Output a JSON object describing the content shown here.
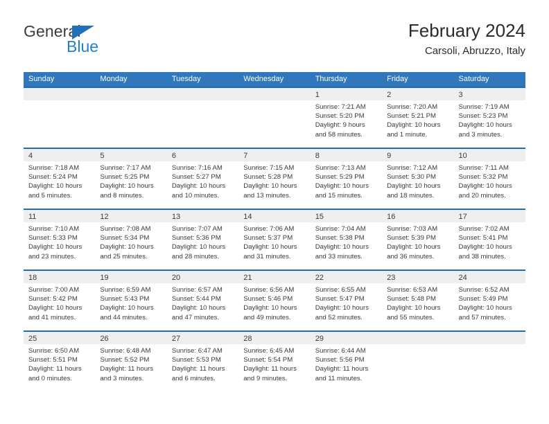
{
  "brand": {
    "name_part1": "General",
    "name_part2": "Blue",
    "icon": "triangle-logo-icon",
    "color_primary": "#1f7fd0",
    "color_text": "#3c3c3c"
  },
  "header": {
    "title": "February 2024",
    "subtitle": "Carsoli, Abruzzo, Italy"
  },
  "theme": {
    "header_bar": "#3077bc",
    "row_divider": "#1f6cb0",
    "day_band": "#efefef",
    "text": "#3a3a3a"
  },
  "weekdays": [
    "Sunday",
    "Monday",
    "Tuesday",
    "Wednesday",
    "Thursday",
    "Friday",
    "Saturday"
  ],
  "weeks": [
    [
      {
        "day": "",
        "sunrise": "",
        "sunset": "",
        "daylight": "",
        "empty": true
      },
      {
        "day": "",
        "sunrise": "",
        "sunset": "",
        "daylight": "",
        "empty": true
      },
      {
        "day": "",
        "sunrise": "",
        "sunset": "",
        "daylight": "",
        "empty": true
      },
      {
        "day": "",
        "sunrise": "",
        "sunset": "",
        "daylight": "",
        "empty": true
      },
      {
        "day": "1",
        "sunrise": "Sunrise: 7:21 AM",
        "sunset": "Sunset: 5:20 PM",
        "daylight": "Daylight: 9 hours and 58 minutes.",
        "empty": false
      },
      {
        "day": "2",
        "sunrise": "Sunrise: 7:20 AM",
        "sunset": "Sunset: 5:21 PM",
        "daylight": "Daylight: 10 hours and 1 minute.",
        "empty": false
      },
      {
        "day": "3",
        "sunrise": "Sunrise: 7:19 AM",
        "sunset": "Sunset: 5:23 PM",
        "daylight": "Daylight: 10 hours and 3 minutes.",
        "empty": false
      }
    ],
    [
      {
        "day": "4",
        "sunrise": "Sunrise: 7:18 AM",
        "sunset": "Sunset: 5:24 PM",
        "daylight": "Daylight: 10 hours and 5 minutes.",
        "empty": false
      },
      {
        "day": "5",
        "sunrise": "Sunrise: 7:17 AM",
        "sunset": "Sunset: 5:25 PM",
        "daylight": "Daylight: 10 hours and 8 minutes.",
        "empty": false
      },
      {
        "day": "6",
        "sunrise": "Sunrise: 7:16 AM",
        "sunset": "Sunset: 5:27 PM",
        "daylight": "Daylight: 10 hours and 10 minutes.",
        "empty": false
      },
      {
        "day": "7",
        "sunrise": "Sunrise: 7:15 AM",
        "sunset": "Sunset: 5:28 PM",
        "daylight": "Daylight: 10 hours and 13 minutes.",
        "empty": false
      },
      {
        "day": "8",
        "sunrise": "Sunrise: 7:13 AM",
        "sunset": "Sunset: 5:29 PM",
        "daylight": "Daylight: 10 hours and 15 minutes.",
        "empty": false
      },
      {
        "day": "9",
        "sunrise": "Sunrise: 7:12 AM",
        "sunset": "Sunset: 5:30 PM",
        "daylight": "Daylight: 10 hours and 18 minutes.",
        "empty": false
      },
      {
        "day": "10",
        "sunrise": "Sunrise: 7:11 AM",
        "sunset": "Sunset: 5:32 PM",
        "daylight": "Daylight: 10 hours and 20 minutes.",
        "empty": false
      }
    ],
    [
      {
        "day": "11",
        "sunrise": "Sunrise: 7:10 AM",
        "sunset": "Sunset: 5:33 PM",
        "daylight": "Daylight: 10 hours and 23 minutes.",
        "empty": false
      },
      {
        "day": "12",
        "sunrise": "Sunrise: 7:08 AM",
        "sunset": "Sunset: 5:34 PM",
        "daylight": "Daylight: 10 hours and 25 minutes.",
        "empty": false
      },
      {
        "day": "13",
        "sunrise": "Sunrise: 7:07 AM",
        "sunset": "Sunset: 5:36 PM",
        "daylight": "Daylight: 10 hours and 28 minutes.",
        "empty": false
      },
      {
        "day": "14",
        "sunrise": "Sunrise: 7:06 AM",
        "sunset": "Sunset: 5:37 PM",
        "daylight": "Daylight: 10 hours and 31 minutes.",
        "empty": false
      },
      {
        "day": "15",
        "sunrise": "Sunrise: 7:04 AM",
        "sunset": "Sunset: 5:38 PM",
        "daylight": "Daylight: 10 hours and 33 minutes.",
        "empty": false
      },
      {
        "day": "16",
        "sunrise": "Sunrise: 7:03 AM",
        "sunset": "Sunset: 5:39 PM",
        "daylight": "Daylight: 10 hours and 36 minutes.",
        "empty": false
      },
      {
        "day": "17",
        "sunrise": "Sunrise: 7:02 AM",
        "sunset": "Sunset: 5:41 PM",
        "daylight": "Daylight: 10 hours and 38 minutes.",
        "empty": false
      }
    ],
    [
      {
        "day": "18",
        "sunrise": "Sunrise: 7:00 AM",
        "sunset": "Sunset: 5:42 PM",
        "daylight": "Daylight: 10 hours and 41 minutes.",
        "empty": false
      },
      {
        "day": "19",
        "sunrise": "Sunrise: 6:59 AM",
        "sunset": "Sunset: 5:43 PM",
        "daylight": "Daylight: 10 hours and 44 minutes.",
        "empty": false
      },
      {
        "day": "20",
        "sunrise": "Sunrise: 6:57 AM",
        "sunset": "Sunset: 5:44 PM",
        "daylight": "Daylight: 10 hours and 47 minutes.",
        "empty": false
      },
      {
        "day": "21",
        "sunrise": "Sunrise: 6:56 AM",
        "sunset": "Sunset: 5:46 PM",
        "daylight": "Daylight: 10 hours and 49 minutes.",
        "empty": false
      },
      {
        "day": "22",
        "sunrise": "Sunrise: 6:55 AM",
        "sunset": "Sunset: 5:47 PM",
        "daylight": "Daylight: 10 hours and 52 minutes.",
        "empty": false
      },
      {
        "day": "23",
        "sunrise": "Sunrise: 6:53 AM",
        "sunset": "Sunset: 5:48 PM",
        "daylight": "Daylight: 10 hours and 55 minutes.",
        "empty": false
      },
      {
        "day": "24",
        "sunrise": "Sunrise: 6:52 AM",
        "sunset": "Sunset: 5:49 PM",
        "daylight": "Daylight: 10 hours and 57 minutes.",
        "empty": false
      }
    ],
    [
      {
        "day": "25",
        "sunrise": "Sunrise: 6:50 AM",
        "sunset": "Sunset: 5:51 PM",
        "daylight": "Daylight: 11 hours and 0 minutes.",
        "empty": false
      },
      {
        "day": "26",
        "sunrise": "Sunrise: 6:48 AM",
        "sunset": "Sunset: 5:52 PM",
        "daylight": "Daylight: 11 hours and 3 minutes.",
        "empty": false
      },
      {
        "day": "27",
        "sunrise": "Sunrise: 6:47 AM",
        "sunset": "Sunset: 5:53 PM",
        "daylight": "Daylight: 11 hours and 6 minutes.",
        "empty": false
      },
      {
        "day": "28",
        "sunrise": "Sunrise: 6:45 AM",
        "sunset": "Sunset: 5:54 PM",
        "daylight": "Daylight: 11 hours and 9 minutes.",
        "empty": false
      },
      {
        "day": "29",
        "sunrise": "Sunrise: 6:44 AM",
        "sunset": "Sunset: 5:56 PM",
        "daylight": "Daylight: 11 hours and 11 minutes.",
        "empty": false
      },
      {
        "day": "",
        "sunrise": "",
        "sunset": "",
        "daylight": "",
        "empty": true
      },
      {
        "day": "",
        "sunrise": "",
        "sunset": "",
        "daylight": "",
        "empty": true
      }
    ]
  ]
}
